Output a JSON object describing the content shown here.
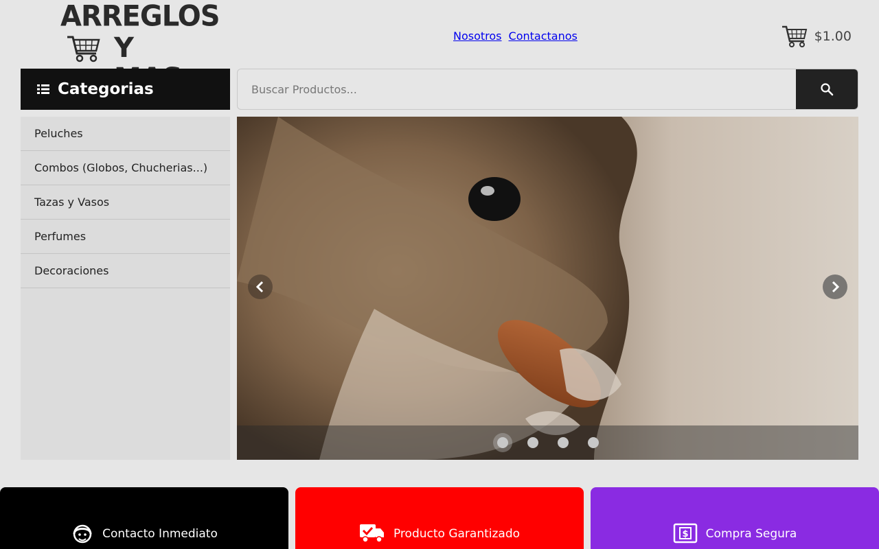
{
  "brand": {
    "logo_line1": "ARREGLOS",
    "logo_line2": "Y MAS"
  },
  "nav": {
    "links": [
      "Nosotros",
      "Contactanos"
    ]
  },
  "cart": {
    "icon": "shopping-cart-icon",
    "total": "$1.00"
  },
  "categories": {
    "title": "Categorias",
    "icon": "list-icon",
    "items": [
      "Peluches",
      "Combos (Globos, Chucherias...)",
      "Tazas y Vasos",
      "Perfumes",
      "Decoraciones"
    ]
  },
  "search": {
    "placeholder": "Buscar Productos...",
    "value": "",
    "icon": "search-icon"
  },
  "carousel": {
    "slide_count": 4,
    "active_index": 0,
    "image_subject": "squirrel eating almond"
  },
  "features": [
    {
      "label": "Contacto Inmediato",
      "icon": "support-agent-icon",
      "color": "#000000"
    },
    {
      "label": "Producto Garantizado",
      "icon": "delivery-truck-check-icon",
      "color": "#ff0000"
    },
    {
      "label": "Compra Segura",
      "icon": "money-bill-icon",
      "color": "#8a2be2"
    }
  ]
}
